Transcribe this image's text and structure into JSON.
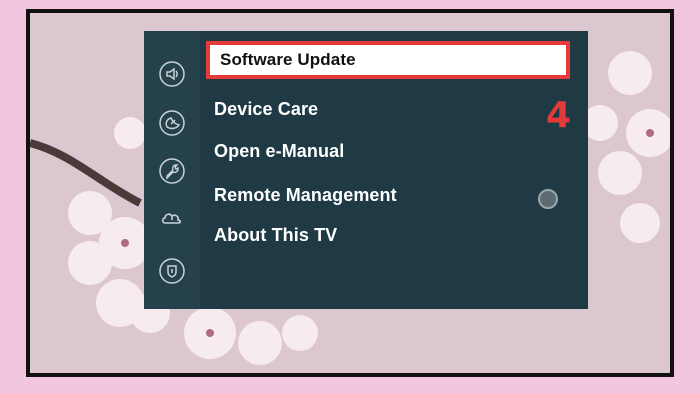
{
  "menu": {
    "items": [
      {
        "label": "Software Update",
        "selected": true
      },
      {
        "label": "Device Care"
      },
      {
        "label": "Open e-Manual"
      },
      {
        "label": "Remote Management"
      },
      {
        "label": "About This TV"
      }
    ]
  },
  "sidebar_icons": [
    "sound-icon",
    "satellite-dish-icon",
    "wrench-icon",
    "cloud-support-icon",
    "shield-icon"
  ],
  "annotation": {
    "step_number": "4"
  },
  "colors": {
    "panel": "#1f3a44",
    "rail": "#25424c",
    "highlight_border": "#e53a3a",
    "outer_background": "#f3c6df"
  }
}
